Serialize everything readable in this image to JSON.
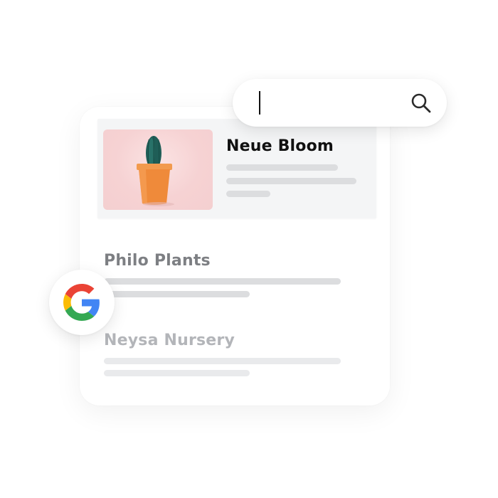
{
  "search": {
    "value": "",
    "placeholder": ""
  },
  "featured_result": {
    "title": "Neue Bloom",
    "image": "potted-cactus-image"
  },
  "results": [
    {
      "title": "Philo Plants"
    },
    {
      "title": "Neysa Nursery"
    }
  ],
  "icons": {
    "search": "search-icon",
    "google": "google-g-icon"
  },
  "colors": {
    "google_blue": "#4285F4",
    "google_red": "#EA4335",
    "google_yellow": "#FBBC05",
    "google_green": "#34A853",
    "pot": "#ef8a3a",
    "cactus": "#1f5e57"
  }
}
